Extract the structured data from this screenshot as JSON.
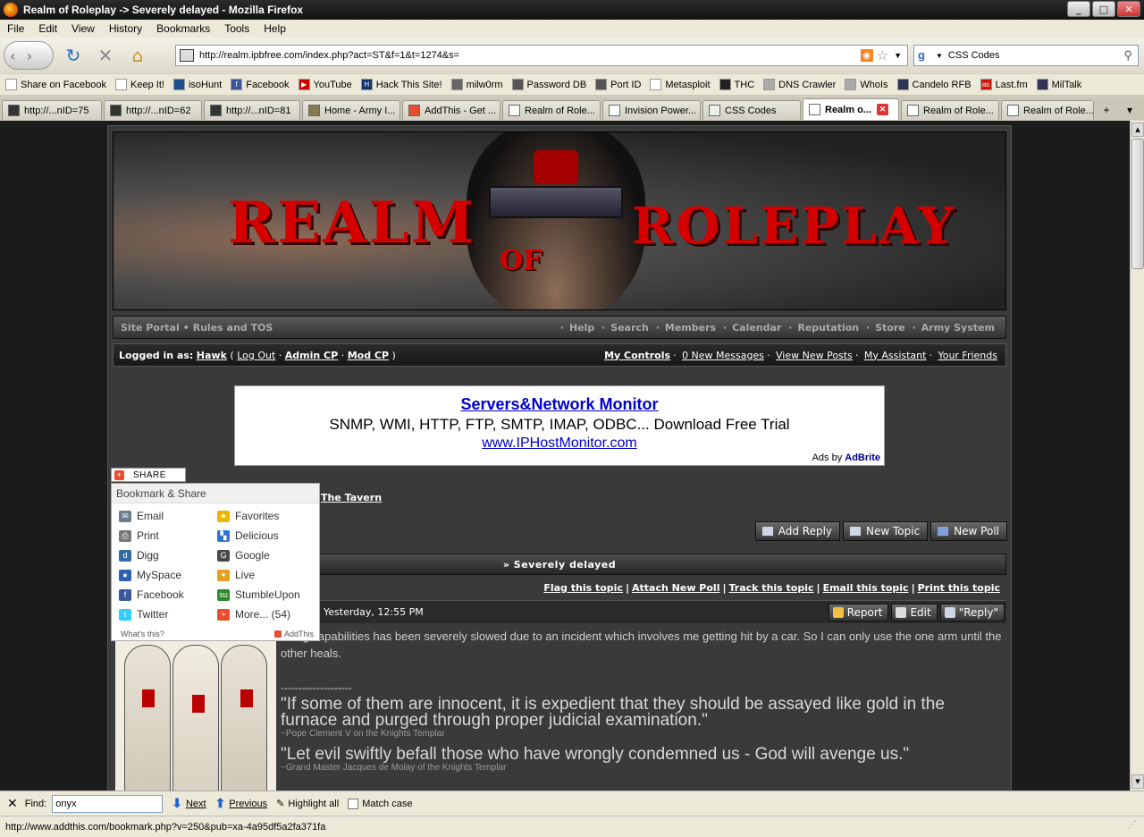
{
  "window": {
    "title": "Realm of Roleplay -> Severely delayed - Mozilla Firefox"
  },
  "menu": [
    "File",
    "Edit",
    "View",
    "History",
    "Bookmarks",
    "Tools",
    "Help"
  ],
  "navbar": {
    "url": "http://realm.ipbfree.com/index.php?act=ST&f=1&t=1274&s=",
    "search_engine": "google-icon",
    "search_value": "CSS Codes"
  },
  "bookmarks": [
    "Share on Facebook",
    "Keep It!",
    "isoHunt",
    "Facebook",
    "YouTube",
    "Hack This Site!",
    "milw0rm",
    "Password DB",
    "Port ID",
    "Metasploit",
    "THC",
    "DNS Crawler",
    "WhoIs",
    "Candelo RFB",
    "Last.fm",
    "MilTalk"
  ],
  "tabs": [
    {
      "label": "http://...nID=75"
    },
    {
      "label": "http://...nID=62"
    },
    {
      "label": "http://...nID=81"
    },
    {
      "label": "Home - Army I..."
    },
    {
      "label": "AddThis - Get ..."
    },
    {
      "label": "Realm of Role..."
    },
    {
      "label": "Invision Power..."
    },
    {
      "label": "CSS Codes"
    },
    {
      "label": "Realm o..."
    },
    {
      "label": "Realm of Role..."
    },
    {
      "label": "Realm of Role..."
    }
  ],
  "banner": {
    "word1": "REALM",
    "word2": "OF",
    "word3": "ROLEPLAY"
  },
  "forum_nav": {
    "left": [
      "Site Portal",
      "Rules and TOS"
    ],
    "right": [
      "Help",
      "Search",
      "Members",
      "Calendar",
      "Reputation",
      "Store",
      "Army System"
    ]
  },
  "user_bar": {
    "logged_prefix": "Logged in as:",
    "username": "Hawk",
    "links": [
      "Log Out",
      "Admin CP",
      "Mod CP"
    ],
    "right_links": [
      "My Controls",
      "0 New Messages",
      "View New Posts",
      "My Assistant",
      "Your Friends"
    ]
  },
  "ad": {
    "headline": "Servers&Network Monitor",
    "line2": "SNMP, WMI, HTTP, FTP, SMTP, IMAP, ODBC... Download Free Trial",
    "link": "www.IPHostMonitor.com",
    "by": "Ads by",
    "brand": "AdBrite"
  },
  "breadcrumb": "The Tavern",
  "topic_buttons": [
    "Add Reply",
    "New Topic",
    "New Poll"
  ],
  "topic_title": "» Severely delayed",
  "topic_options": [
    "Flag this topic",
    "Attach New Poll",
    "Track this topic",
    "Email this topic",
    "Print this topic"
  ],
  "post": {
    "date": "Yesterday, 12:55 PM",
    "buttons": [
      "Report",
      "Edit",
      "\"Reply\""
    ],
    "body": "...ting capabilities has been severely slowed due to an incident which involves me getting hit by a car. So I can only use the one arm until the other heals.",
    "sig_line": "--------------------",
    "quote1": "\"If some of them are innocent, it is expedient that they should be assayed like gold in the furnace and purged through proper judicial examination.\"",
    "quote1_attr": "~Pope Clement V on the Knights Templar",
    "quote2": "\"Let evil swiftly befall those who have wrongly condemned us - God will avenge us.\"",
    "quote2_attr": "~Grand Master Jacques de Molay of the Knights Templar"
  },
  "share_popup": {
    "button": "SHARE",
    "header": "Bookmark & Share",
    "items": [
      {
        "label": "Email",
        "color": "#6b7b8c"
      },
      {
        "label": "Favorites",
        "color": "#f0b400"
      },
      {
        "label": "Print",
        "color": "#777777"
      },
      {
        "label": "Delicious",
        "color": "#3274d1"
      },
      {
        "label": "Digg",
        "color": "#356aa0"
      },
      {
        "label": "Google",
        "color": "#4a4a4a"
      },
      {
        "label": "MySpace",
        "color": "#2d5fb3"
      },
      {
        "label": "Live",
        "color": "#e5a020"
      },
      {
        "label": "Facebook",
        "color": "#3b5998"
      },
      {
        "label": "StumbleUpon",
        "color": "#2c8a2c"
      },
      {
        "label": "Twitter",
        "color": "#33ccff"
      },
      {
        "label": "More... (54)",
        "color": "#e84d2f"
      }
    ],
    "whats_this": "What's this?",
    "brand": "AddThis"
  },
  "findbar": {
    "label": "Find:",
    "value": "onyx",
    "next": "Next",
    "previous": "Previous",
    "highlight": "Highlight all",
    "match_case": "Match case"
  },
  "status": "http://www.addthis.com/bookmark.php?v=250&pub=xa-4a95df5a2fa371fa"
}
